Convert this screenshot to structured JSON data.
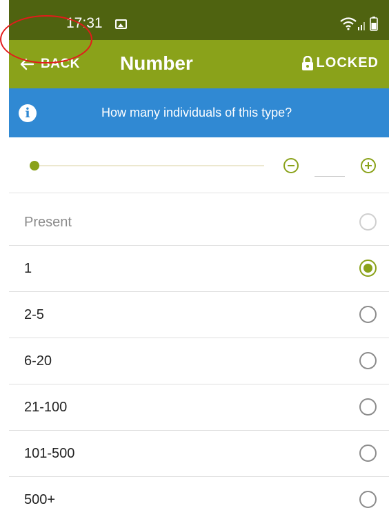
{
  "status_bar": {
    "time": "17:31",
    "icons": [
      "gallery-icon",
      "wifi-icon",
      "signal-icon",
      "battery-icon"
    ]
  },
  "app_bar": {
    "back_label": "BACK",
    "title": "Number",
    "locked_label": "LOCKED",
    "background": "#8aa21a"
  },
  "info_bar": {
    "icon": "info-icon",
    "text": "How many individuals of this type?",
    "background": "#3089d3"
  },
  "counter": {
    "value": "",
    "slider_fraction": 0
  },
  "options": [
    {
      "label": "Present",
      "selected": false,
      "disabled": true
    },
    {
      "label": "1",
      "selected": true,
      "disabled": false
    },
    {
      "label": "2-5",
      "selected": false,
      "disabled": false
    },
    {
      "label": "6-20",
      "selected": false,
      "disabled": false
    },
    {
      "label": "21-100",
      "selected": false,
      "disabled": false
    },
    {
      "label": "101-500",
      "selected": false,
      "disabled": false
    },
    {
      "label": "500+",
      "selected": false,
      "disabled": false
    }
  ],
  "annotation": {
    "highlight_color": "#e31b1b",
    "highlighted_element": "back-button"
  }
}
